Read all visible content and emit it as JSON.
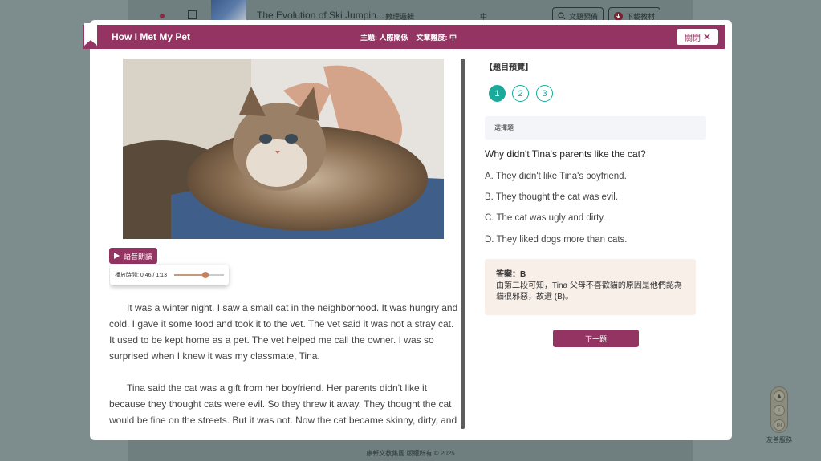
{
  "background": {
    "row_title": "The Evolution of Ski Jumpin...",
    "row_category": "數理邏輯",
    "row_level": "中",
    "btn_question": "文題預備",
    "btn_download": "下載教材",
    "footer": "康軒文教集團 版權所有 © 2025",
    "float_label": "友善服務"
  },
  "modal": {
    "title": "How I Met My Pet",
    "topic": "主題: 人際關係",
    "difficulty": "文章難度: 中",
    "close_label": "關閉"
  },
  "audio": {
    "button_label": "語音朗讀",
    "time_text": "播放時間: 0:46 / 1:13",
    "progress": 0.63
  },
  "story": {
    "paragraphs": [
      "It was a winter night. I saw a small cat in the neighborhood. It was hungry and cold. I gave it some food and took it to the vet. The vet said it was not a stray cat. It used to be kept home as a pet. The vet helped me call the owner. I was so surprised when I knew it was my classmate, Tina.",
      "Tina said the cat was a gift from her boyfriend. Her parents didn't like it because they thought cats were evil. So they threw it away. They thought the cat would be fine on the streets. But it was not. Now the cat became skinny, dirty, and sick. Tina"
    ]
  },
  "quiz": {
    "preview_label": "【題目預覽】",
    "numbers": [
      "1",
      "2",
      "3"
    ],
    "active_index": 0,
    "type_label": "選擇題",
    "question": "Why didn't Tina's parents like the cat?",
    "options": [
      "A. They didn't like Tina's boyfriend.",
      "B. They thought the cat was evil.",
      "C. The cat was ugly and dirty.",
      "D. They liked dogs more than cats."
    ],
    "answer_title": "答案：B",
    "answer_explanation": "由第二段可知，Tina 父母不喜歡貓的原因是他們認為貓很邪惡，故選 (B)。",
    "next_label": "下一題"
  },
  "colors": {
    "brand": "#943463",
    "accent": "#1aaa9a"
  }
}
